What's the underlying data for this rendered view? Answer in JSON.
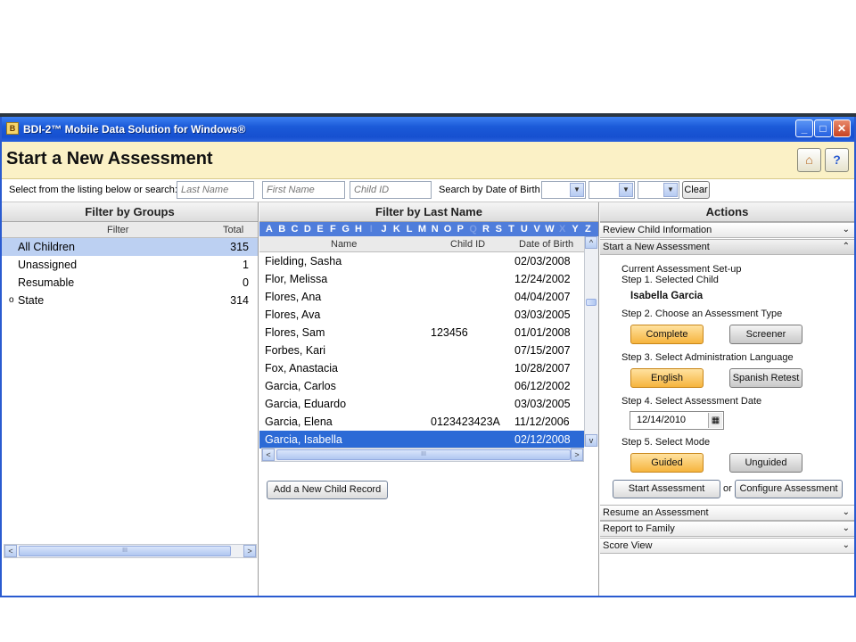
{
  "window": {
    "title": "BDI-2™ Mobile Data Solution for Windows®",
    "icon": "app-icon",
    "minimize_glyph": "_",
    "maximize_glyph": "□",
    "close_glyph": "✕"
  },
  "header": {
    "title": "Start a New Assessment",
    "home_icon": "⌂",
    "help_icon": "?"
  },
  "search": {
    "prompt": "Select from the listing below or search:",
    "last_name_placeholder": "Last Name",
    "first_name_placeholder": "First Name",
    "child_id_placeholder": "Child ID",
    "dob_label": "Search by Date of Birth",
    "dropdown_glyph": "▼",
    "clear_label": "Clear"
  },
  "groups": {
    "heading": "Filter by Groups",
    "col_filter": "Filter",
    "col_total": "Total",
    "rows": [
      {
        "label": "All Children",
        "total": "315"
      },
      {
        "label": "Unassigned",
        "total": "1"
      },
      {
        "label": "Resumable",
        "total": "0"
      },
      {
        "label": "State",
        "total": "314"
      }
    ],
    "state_marker": "o",
    "scroll_left": "<",
    "scroll_right": ">",
    "scroll_grip": "III"
  },
  "names": {
    "heading": "Filter by Last Name",
    "alphabet": [
      "A",
      "B",
      "C",
      "D",
      "E",
      "F",
      "G",
      "H",
      "I",
      "J",
      "K",
      "L",
      "M",
      "N",
      "O",
      "P",
      "Q",
      "R",
      "S",
      "T",
      "U",
      "V",
      "W",
      "X",
      "Y",
      "Z"
    ],
    "dim_letters": [
      "I",
      "Q",
      "X"
    ],
    "col_name": "Name",
    "col_child_id": "Child ID",
    "col_dob": "Date of Birth",
    "rows": [
      {
        "name": "Fielding, Sasha",
        "child_id": "",
        "dob": "02/03/2008"
      },
      {
        "name": "Flor, Melissa",
        "child_id": "",
        "dob": "12/24/2002"
      },
      {
        "name": "Flores, Ana",
        "child_id": "",
        "dob": "04/04/2007"
      },
      {
        "name": "Flores, Ava",
        "child_id": "",
        "dob": "03/03/2005"
      },
      {
        "name": "Flores, Sam",
        "child_id": "123456",
        "dob": "01/01/2008"
      },
      {
        "name": "Forbes, Kari",
        "child_id": "",
        "dob": "07/15/2007"
      },
      {
        "name": "Fox, Anastacia",
        "child_id": "",
        "dob": "10/28/2007"
      },
      {
        "name": "Garcia, Carlos",
        "child_id": "",
        "dob": "06/12/2002"
      },
      {
        "name": "Garcia, Eduardo",
        "child_id": "",
        "dob": "03/03/2005"
      },
      {
        "name": "Garcia, Elena",
        "child_id": "0123423423A",
        "dob": "11/12/2006"
      },
      {
        "name": "Garcia, Isabella",
        "child_id": "",
        "dob": "02/12/2008"
      }
    ],
    "add_child_label": "Add a New Child Record",
    "scroll_up": "^",
    "scroll_down": "v",
    "scroll_left": "<",
    "scroll_right": ">",
    "scroll_grip": "III"
  },
  "actions": {
    "heading": "Actions",
    "sections": {
      "review": "Review Child Information",
      "start": "Start a New Assessment",
      "resume": "Resume an Assessment",
      "report": "Report to Family",
      "score": "Score View"
    },
    "chevron_down": "⌄",
    "chevron_up": "⌃",
    "setup_title": "Current Assessment Set-up",
    "step1": "Step 1. Selected Child",
    "selected_child": "Isabella Garcia",
    "step2": "Step 2. Choose an Assessment Type",
    "type_complete": "Complete",
    "type_screener": "Screener",
    "step3": "Step 3. Select Administration Language",
    "lang_english": "English",
    "lang_spanish": "Spanish Retest",
    "step4": "Step 4. Select Assessment Date",
    "assessment_date": "12/14/2010",
    "calendar_icon": "▦",
    "step5": "Step 5. Select Mode",
    "mode_guided": "Guided",
    "mode_unguided": "Unguided",
    "start_label": "Start Assessment",
    "or_label": "or",
    "configure_label": "Configure Assessment"
  },
  "colors": {
    "title_bar": "#1b5ad8",
    "header_bg": "#fbf1c6",
    "selected_row": "#2c6ad6",
    "orange_button": "#f6b43e"
  }
}
